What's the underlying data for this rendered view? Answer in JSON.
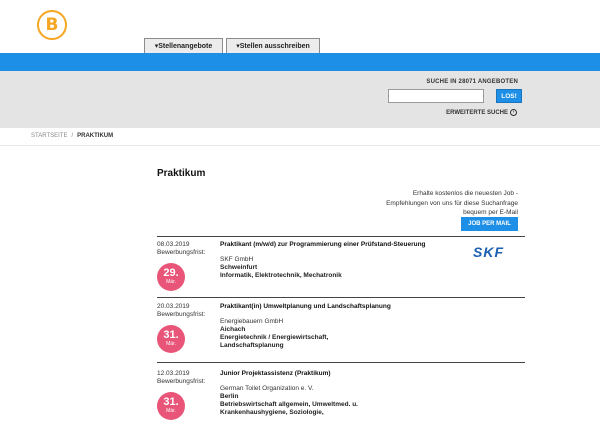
{
  "header": {
    "logo_letter": "B",
    "tabs": [
      "▾Stellenangebote",
      "▾Stellen ausschreiben"
    ],
    "accent_color": "#1e8fe6"
  },
  "search": {
    "label": "SUCHE IN 28071 ANGEBOTEN",
    "input_value": "",
    "button": "LOS!",
    "advanced": "ERWEITERTE SUCHE"
  },
  "breadcrumb": {
    "home": "STARTSEITE",
    "separator": "/",
    "current": "PRAKTIKUM"
  },
  "page_title": "Praktikum",
  "alert": {
    "line1": "Erhalte kostenlos die neuesten Job -",
    "line2": "Empfehlungen von uns für diese Suchanfrage",
    "line3": "bequem per E-Mail",
    "button": "JOB PER MAIL"
  },
  "listings": [
    {
      "date": "08.03.2019",
      "deadline_label": "Bewerbungsfrist:",
      "deadline_day": "29.",
      "deadline_month": "Mär.",
      "title": "Praktikant (m/w/d) zur Programmierung einer Prüfstand-Steuerung",
      "company": "SKF GmbH",
      "city": "Schweinfurt",
      "category": "Informatik, Elektrotechnik, Mechatronik",
      "logo": "SKF"
    },
    {
      "date": "20.03.2019",
      "deadline_label": "Bewerbungsfrist:",
      "deadline_day": "31.",
      "deadline_month": "Mär.",
      "title": "Praktikant(in) Umweltplanung und Landschaftsplanung",
      "company": "Energiebauern GmbH",
      "city": "Aichach",
      "category": "Energietechnik / Energiewirtschaft, Landschaftsplanung"
    },
    {
      "date": "12.03.2019",
      "deadline_label": "Bewerbungsfrist:",
      "deadline_day": "31.",
      "deadline_month": "Mär.",
      "title": "Junior Projektassistenz (Praktikum)",
      "company": "German Toilet Organization e. V.",
      "city": "Berlin",
      "category": "Betriebswirtschaft allgemein, Umweltmed. u. Krankenhaushygiene, Soziologie,"
    }
  ]
}
